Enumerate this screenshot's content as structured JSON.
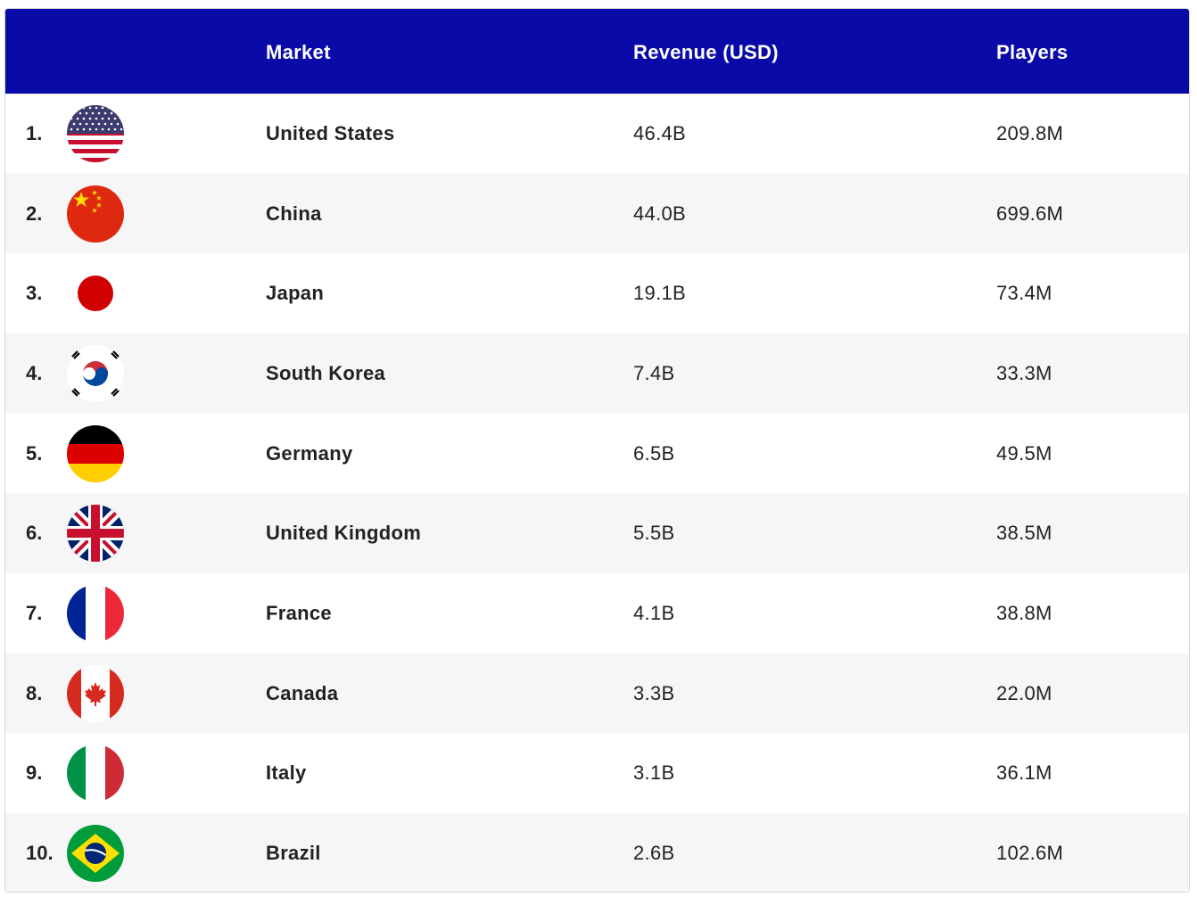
{
  "header": {
    "market": "Market",
    "revenue": "Revenue (USD)",
    "players": "Players"
  },
  "rows": [
    {
      "rank": "1.",
      "flag": "us-flag-icon",
      "market": "United States",
      "revenue": "46.4B",
      "players": "209.8M"
    },
    {
      "rank": "2.",
      "flag": "china-flag-icon",
      "market": "China",
      "revenue": "44.0B",
      "players": "699.6M"
    },
    {
      "rank": "3.",
      "flag": "japan-flag-icon",
      "market": "Japan",
      "revenue": "19.1B",
      "players": "73.4M"
    },
    {
      "rank": "4.",
      "flag": "south-korea-flag-icon",
      "market": "South Korea",
      "revenue": "7.4B",
      "players": "33.3M"
    },
    {
      "rank": "5.",
      "flag": "germany-flag-icon",
      "market": "Germany",
      "revenue": "6.5B",
      "players": "49.5M"
    },
    {
      "rank": "6.",
      "flag": "uk-flag-icon",
      "market": "United Kingdom",
      "revenue": "5.5B",
      "players": "38.5M"
    },
    {
      "rank": "7.",
      "flag": "france-flag-icon",
      "market": "France",
      "revenue": "4.1B",
      "players": "38.8M"
    },
    {
      "rank": "8.",
      "flag": "canada-flag-icon",
      "market": "Canada",
      "revenue": "3.3B",
      "players": "22.0M"
    },
    {
      "rank": "9.",
      "flag": "italy-flag-icon",
      "market": "Italy",
      "revenue": "3.1B",
      "players": "36.1M"
    },
    {
      "rank": "10.",
      "flag": "brazil-flag-icon",
      "market": "Brazil",
      "revenue": "2.6B",
      "players": "102.6M"
    }
  ],
  "colors": {
    "header_bg": "#0a0aa8",
    "header_text": "#ffffff",
    "alt_row_bg": "#f6f6f6"
  }
}
